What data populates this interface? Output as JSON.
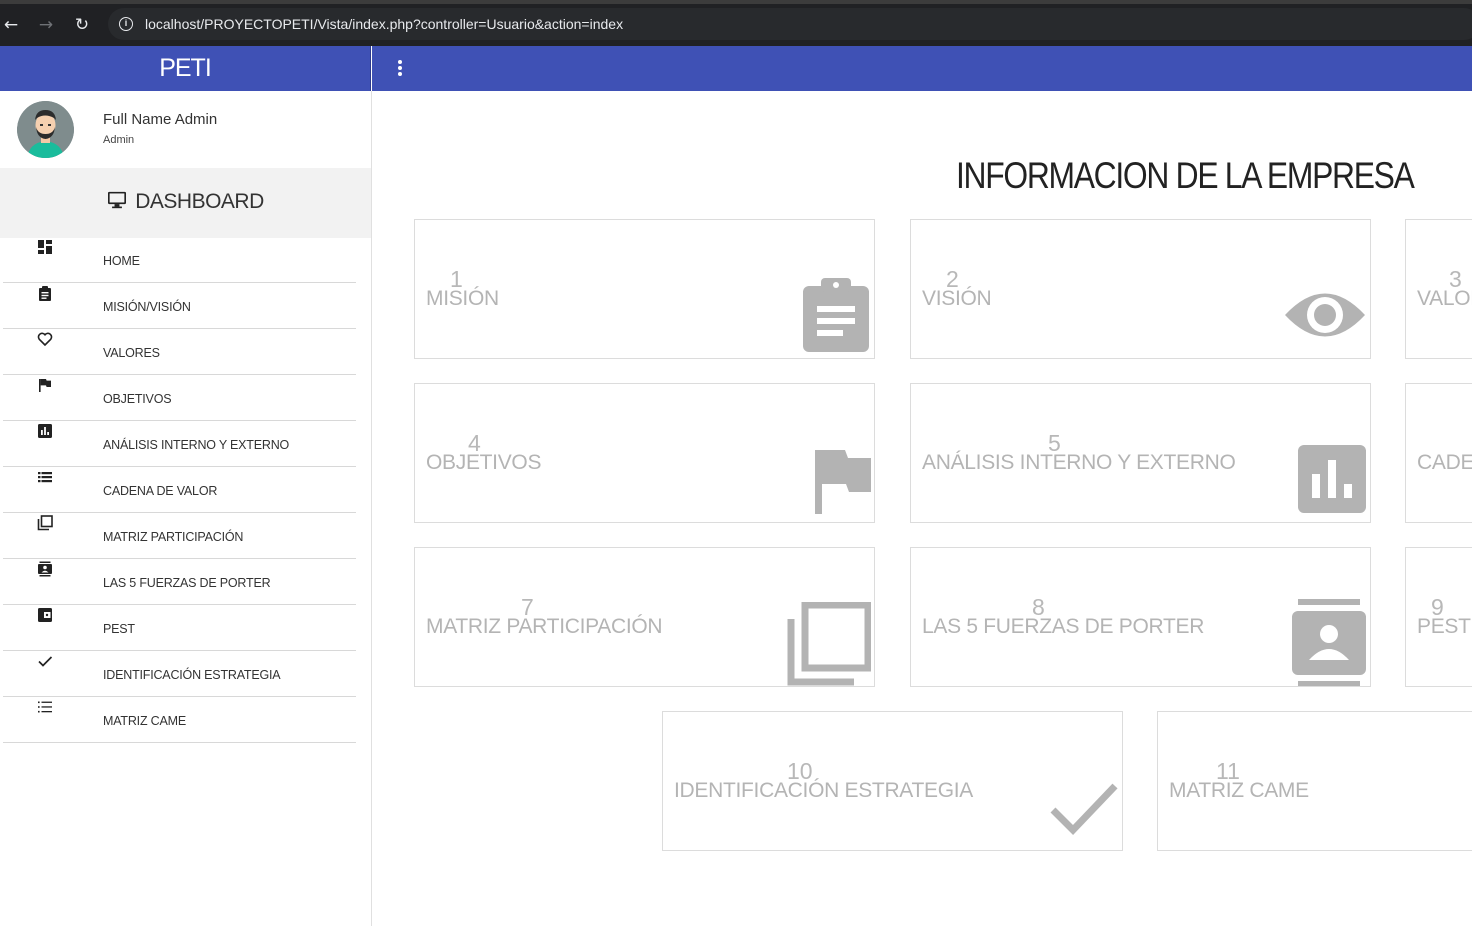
{
  "browser": {
    "url": "localhost/PROYECTOPETI/Vista/index.php?controller=Usuario&action=index",
    "back_icon": "arrow-left-icon",
    "forward_icon": "arrow-right-icon",
    "reload_icon": "reload-icon"
  },
  "brand": "PETI",
  "user": {
    "name": "Full Name Admin",
    "role": "Admin"
  },
  "sidebar": {
    "header": "DASHBOARD",
    "items": [
      {
        "label": "HOME",
        "icon": "dashboard-icon"
      },
      {
        "label": "MISIÓN/VISIÓN",
        "icon": "clipboard-icon"
      },
      {
        "label": "VALORES",
        "icon": "heart-icon"
      },
      {
        "label": "OBJETIVOS",
        "icon": "flag-icon"
      },
      {
        "label": "ANÁLISIS INTERNO Y EXTERNO",
        "icon": "chart-icon"
      },
      {
        "label": "CADENA DE VALOR",
        "icon": "list-icon"
      },
      {
        "label": "MATRIZ PARTICIPACIÓN",
        "icon": "library-icon"
      },
      {
        "label": "LAS 5 FUERZAS DE PORTER",
        "icon": "contacts-icon"
      },
      {
        "label": "PEST",
        "icon": "wallet-icon"
      },
      {
        "label": "IDENTIFICACIÓN ESTRATEGIA",
        "icon": "check-icon"
      },
      {
        "label": "MATRIZ CAME",
        "icon": "format-list-icon"
      }
    ]
  },
  "main": {
    "title": "INFORMACION DE LA EMPRESA",
    "cards": [
      {
        "num": "1",
        "title": "MISIÓN",
        "icon": "clipboard-icon"
      },
      {
        "num": "2",
        "title": "VISIÓN",
        "icon": "eye-icon"
      },
      {
        "num": "3",
        "title": "VALOR",
        "icon": ""
      },
      {
        "num": "4",
        "title": "OBJETIVOS",
        "icon": "flag-icon"
      },
      {
        "num": "5",
        "title": "ANÁLISIS INTERNO Y EXTERNO",
        "icon": "chart-icon"
      },
      {
        "num": "",
        "title": "CADEN",
        "icon": ""
      },
      {
        "num": "7",
        "title": "MATRIZ PARTICIPACIÓN",
        "icon": "library-icon"
      },
      {
        "num": "8",
        "title": "LAS 5 FUERZAS DE PORTER",
        "icon": "contacts-icon"
      },
      {
        "num": "9",
        "title": "PEST",
        "icon": ""
      },
      {
        "num": "10",
        "title": "IDENTIFICACIÓN ESTRATEGIA",
        "icon": "check-icon"
      },
      {
        "num": "11",
        "title": "MATRIZ CAME",
        "icon": ""
      }
    ]
  },
  "colors": {
    "primary": "#3f51b5",
    "icon_gray": "#b3b3b3",
    "card_text": "#b4b4b4"
  }
}
